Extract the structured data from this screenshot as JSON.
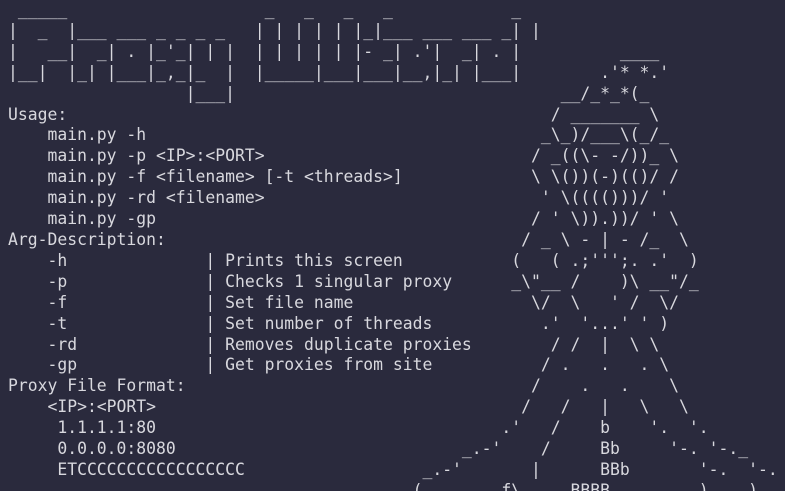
{
  "terminal": {
    "lines": [
      " _____                    _   _   _   _            _",
      "|  _  |___ ___ _ _ _ _   | | | | | |_|___ ___ ___ _| |",
      "|   __|  _| . |_'_| | |  | | | | | |- _| .'|  _| . |          ____",
      "|__|  |_| |___|_,_|_  |  |_____|___|___|__,|_| |___|        .'* *.'",
      "                  |___|                                 __/_*_*(_",
      "Usage:                                                 / _______ \\",
      "    main.py -h                                        _\\_)/___\\(_/_",
      "    main.py -p <IP>:<PORT>                           / _((\\- -/))_ \\",
      "    main.py -f <filename> [-t <threads>]             \\ \\())(-)(()/ /",
      "    main.py -rd <filename>                            ' \\(((()))/ '",
      "    main.py -gp                                      / ' \\)).))/ ' \\",
      "Arg-Description:                                    / _ \\ - | - /_  \\",
      "    -h              | Prints this screen           (   ( .;''';. .'  )",
      "    -p              | Checks 1 singular proxy      _\\\"__ /    )\\ __\"/_",
      "    -f              | Set file name                  \\/  \\   ' /  \\/",
      "    -t              | Set number of threads           .'  '...' ' )",
      "    -rd             | Removes duplicate proxies        / /  |  \\ \\",
      "    -gp             | Get proxies from site           / .   .   . \\",
      "Proxy File Format:                                   /    .   .    \\",
      "    <IP>:<PORT>                                     /   /   |   \\   \\",
      "     1.1.1.1:80                                   .'   /    b    '.  '.",
      "     0.0.0.0:8080                             _.-'    /     Bb     '-. '-._",
      "     ETCCCCCCCCCCCCCCCCC                  _.-'       |      BBb       '-.  '-.",
      "                                         (________f\\_____BBBB_________)____)"
    ]
  }
}
